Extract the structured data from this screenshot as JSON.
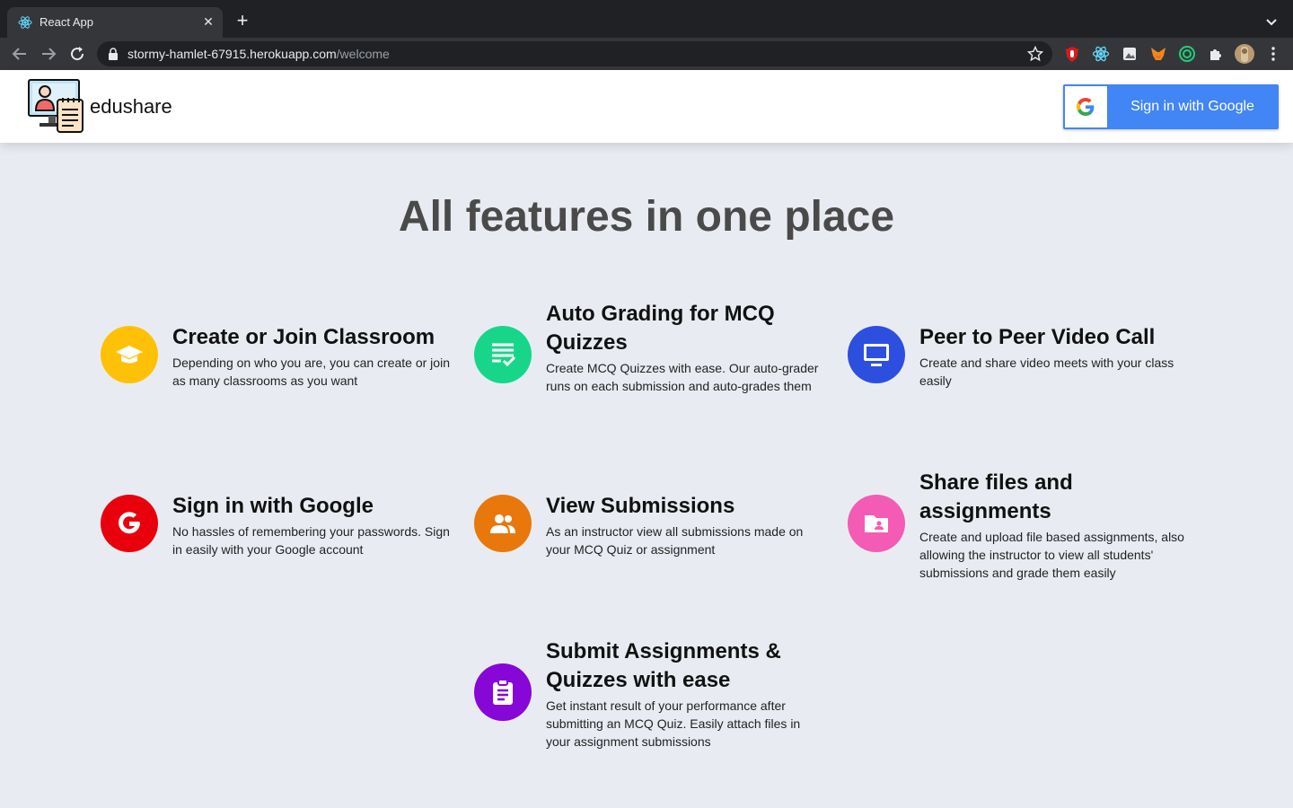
{
  "browser": {
    "tab_title": "React App",
    "url_host": "stormy-hamlet-67915.herokuapp.com",
    "url_path": "/welcome"
  },
  "header": {
    "brand": "edushare",
    "signin_label": "Sign in with Google"
  },
  "main": {
    "title": "All features in one place",
    "features": [
      {
        "title": "Create or Join Classroom",
        "desc": "Depending on who you are, you can create or join as many classrooms as you want",
        "icon": "graduation-cap-icon",
        "color": "#ffc107"
      },
      {
        "title": "Auto Grading for MCQ Quizzes",
        "desc": "Create MCQ Quizzes with ease. Our auto-grader runs on each submission and auto-grades them",
        "icon": "checklist-icon",
        "color": "#17d68a"
      },
      {
        "title": "Peer to Peer Video Call",
        "desc": "Create and share video meets with your class easily",
        "icon": "monitor-icon",
        "color": "#2d4fe0"
      },
      {
        "title": "Sign in with Google",
        "desc": "No hassles of remembering your passwords. Sign in easily with your Google account",
        "icon": "google-g-icon",
        "color": "#e8000d"
      },
      {
        "title": "View Submissions",
        "desc": "As an instructor view all submissions made on your MCQ Quiz or assignment",
        "icon": "people-icon",
        "color": "#e8780c"
      },
      {
        "title": "Share files and assignments",
        "desc": "Create and upload file based assignments, also allowing the instructor to view all students' submissions and grade them easily",
        "icon": "shared-folder-icon",
        "color": "#f35bb4"
      },
      {
        "title": "Submit Assignments & Quizzes with ease",
        "desc": "Get instant result of your performance after submitting an MCQ Quiz. Easily attach files in your assignment submissions",
        "icon": "clipboard-icon",
        "color": "#8707d6"
      }
    ]
  }
}
